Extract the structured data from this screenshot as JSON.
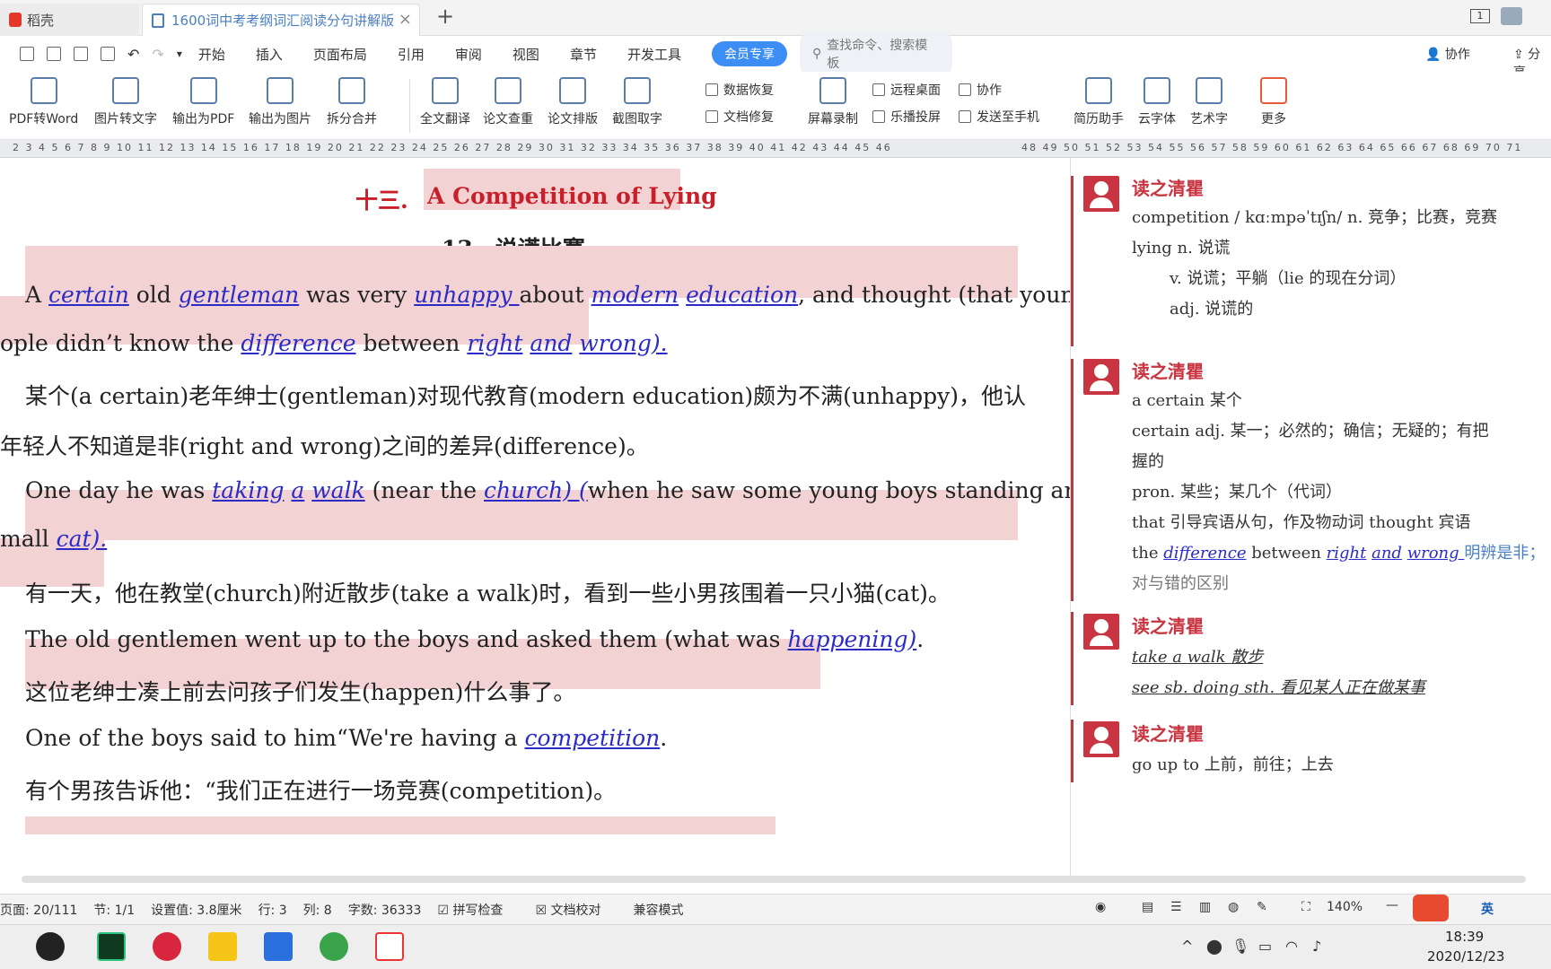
{
  "titlebar": {
    "home_tab": "稻壳",
    "doc_tab": "1600词中考考纲词汇阅读分句讲解版",
    "add_tab": "+",
    "page_count": "1"
  },
  "menu": {
    "items": [
      "开始",
      "插入",
      "页面布局",
      "引用",
      "审阅",
      "视图",
      "章节",
      "开发工具"
    ],
    "member": "会员专享",
    "search_placeholder": "查找命令、搜索模板",
    "collab": "协作",
    "share": "分享"
  },
  "ribbon": {
    "big": [
      "PDF转Word",
      "图片转文字",
      "输出为PDF",
      "输出为图片",
      "拆分合并",
      "全文翻译",
      "论文查重",
      "论文排版",
      "截图取字",
      "屏幕录制",
      "简历助手",
      "云字体",
      "艺术字",
      "更多"
    ],
    "small": [
      "数据恢复",
      "文档修复",
      "远程桌面",
      "协作",
      "乐播投屏",
      "发送至手机"
    ]
  },
  "ruler": {
    "left": "2 3 4 5 6 7 8 9 10 11 12 13 14 15 16 17 18 19 20 21 22 23 24 25 26 27 28 29 30 31 32 33 34 35 36 37 38 39 40 41 42 43 44 45 46",
    "right": "48 49 50 51 52 53 54 55 56 57 58 59 60 61 62 63 64 65 66 67 68 69 70 71"
  },
  "doc": {
    "heading_num": "十三.",
    "heading_en": "A Competition of Lying",
    "heading_cn": "13、说谎比赛",
    "p1": {
      "t1": "A ",
      "w1": "certain",
      "t2": " old ",
      "w2": "gentleman",
      "t3": " was very ",
      "w3": "unhappy ",
      "t4": "about ",
      "w4": "modern",
      "t5": " ",
      "w5": "education",
      "t6": ", and thought (that young"
    },
    "p2": {
      "t1": "ople didn’t know the ",
      "w1": "difference",
      "t2": " between ",
      "w2": "right",
      "t3": " ",
      "w3": "and",
      "t4": " ",
      "w4": "wrong)."
    },
    "c1": "某个(a certain)老年绅士(gentleman)对现代教育(modern education)颇为不满(unhappy)，他认",
    "c2": "年轻人不知道是非(right and wrong)之间的差异(difference)。",
    "p3": {
      "t1": "One day he was ",
      "w1": "taking",
      "t2": " ",
      "w2": "a",
      "t3": " ",
      "w3": "walk",
      "t4": " (near the ",
      "w4": "church) (",
      "t5": "when he saw some young boys standing around"
    },
    "p4": {
      "t1": "mall ",
      "w1": "cat)."
    },
    "c3": "有一天，他在教堂(church)附近散步(take a walk)时，看到一些小男孩围着一只小猫(cat)。",
    "p5": {
      "t1": "The old gentlemen went up to the boys and asked them (what was ",
      "w1": "happening)",
      "t2": "."
    },
    "c4": "这位老绅士凑上前去问孩子们发生(happen)什么事了。",
    "p6": {
      "t1": "One of the boys said to him“We're having a ",
      "w1": "competition",
      "t2": "."
    },
    "c5": "有个男孩告诉他：“我们正在进行一场竞赛(competition)。"
  },
  "comments": [
    {
      "author": "读之清瞿",
      "lines": [
        "competition / kɑːmpəˈtɪʃn/ n. 竞争；比赛，竞赛",
        "lying n.  说谎",
        "v. 说谎；平躺（lie 的现在分词）",
        "adj. 说谎的"
      ]
    },
    {
      "author": "读之清瞿",
      "lines": [
        "a certain  某个",
        "certain    adj. 某一；必然的；确信；无疑的；有把",
        "握的",
        "pron. 某些；某几个（代词）",
        "that 引导宾语从句，作及物动词 thought 宾语"
      ],
      "rich": {
        "t1": "the ",
        "w1": "difference",
        "t2": " between ",
        "w2": "right",
        "t3": " ",
        "w3": "and",
        "t4": " ",
        "w4": "wrong ",
        "t5": "明辨是非；"
      },
      "tail": "对与错的区别"
    },
    {
      "author": "读之清瞿",
      "lines": [
        "take a walk  散步",
        "see sb. doing sth.  看见某人正在做某事"
      ]
    },
    {
      "author": "读之清瞿",
      "lines": [
        "go up to  上前，前往；上去"
      ]
    }
  ],
  "status": {
    "page": "页面: 20/111",
    "section": "节: 1/1",
    "setting": "设置值: 3.8厘米",
    "row": "行: 3",
    "col": "列: 8",
    "words": "字数: 36333",
    "spell": "拼写检查",
    "proof": "文档校对",
    "compat": "兼容模式",
    "zoom": "140%"
  },
  "taskbar": {
    "time": "18:39",
    "date": "2020/12/23",
    "ime": "英"
  }
}
